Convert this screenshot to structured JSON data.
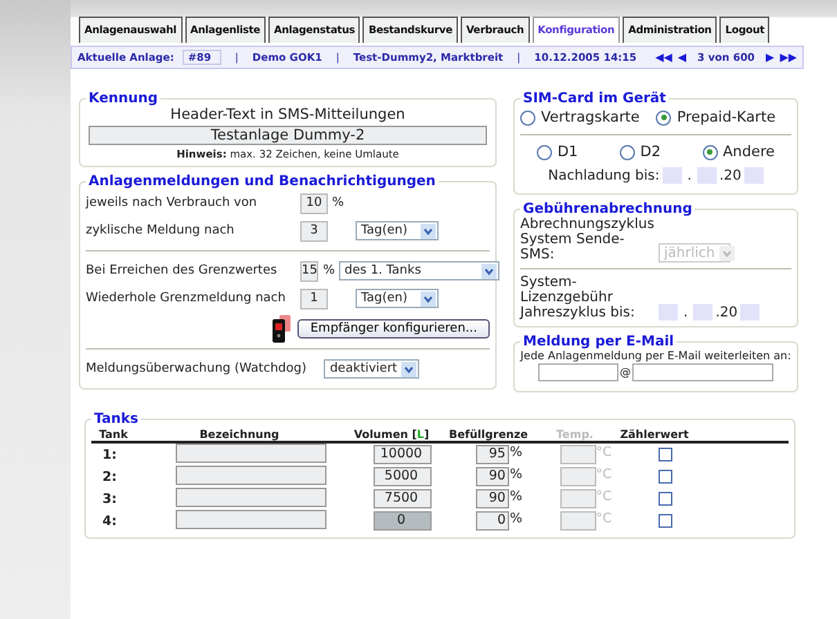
{
  "tabs": [
    {
      "label": "Anlagenauswahl",
      "selected": false
    },
    {
      "label": "Anlagenliste",
      "selected": false
    },
    {
      "label": "Anlagenstatus",
      "selected": false
    },
    {
      "label": "Bestandskurve",
      "selected": false
    },
    {
      "label": "Verbrauch",
      "selected": false
    },
    {
      "label": "Konfiguration",
      "selected": true
    },
    {
      "label": "Administration",
      "selected": false
    },
    {
      "label": "Logout",
      "selected": false
    }
  ],
  "info_bar": {
    "label": "Aktuelle Anlage:",
    "anlage": "#89",
    "items": [
      {
        "kind": "sep",
        "text": "|"
      },
      {
        "kind": "text",
        "text": "Demo GOK1"
      },
      {
        "kind": "sep",
        "text": "|"
      },
      {
        "kind": "text",
        "text": "Test-Dummy2, Marktbreit"
      },
      {
        "kind": "sep",
        "text": "|"
      },
      {
        "kind": "text",
        "text": "10.12.2005 14:15"
      }
    ],
    "nav": {
      "first": "◀◀",
      "prev": "◀",
      "position": "3 von 600",
      "next": "▶",
      "last": "▶▶"
    }
  },
  "kennung": {
    "title": "Kennung",
    "label": "Header-Text in SMS-Mitteilungen",
    "value": "Testanlage Dummy-2",
    "hint": "**Hinweis:** max. 32 Zeichen, keine Umlaute"
  },
  "meldungen": {
    "title": "Anlagenmeldungen und Benachrichtigungen",
    "groups": [
      [
        {
          "label": "jeweils nach Verbrauch von",
          "value": "10",
          "unit": "%"
        },
        {
          "label": "zyklische Meldung nach",
          "value": "3",
          "select": "Tag(en)",
          "wide": false
        }
      ],
      [
        {
          "label": "Bei Erreichen des Grenzwertes",
          "value": "15",
          "unit": "%",
          "select": "des 1. Tanks",
          "wide": true
        },
        {
          "label": "Wiederhole Grenzmeldung nach",
          "value": "1",
          "select": "Tag(en)",
          "wide": false
        }
      ]
    ],
    "button": "Empfänger konfigurieren...",
    "watchdog": {
      "label": "Meldungsüberwachung (Watchdog)",
      "select": "deaktiviert"
    }
  },
  "sim": {
    "title": "SIM-Card im Gerät",
    "card_types": [
      {
        "label": "Vertragskarte",
        "selected": false
      },
      {
        "label": "Prepaid-Karte",
        "selected": true
      }
    ],
    "networks": [
      {
        "label": "D1",
        "selected": false
      },
      {
        "label": "D2",
        "selected": false
      },
      {
        "label": "Andere",
        "selected": true
      }
    ],
    "recharge_label": "Nachladung bis:",
    "date_sep": ".",
    "year_prefix": ".20"
  },
  "gebuehren": {
    "title": "Gebührenabrechnung",
    "cycle_label": "Abrechnungszyklus System Sende-SMS:",
    "cycle_select": "jährlich",
    "license_label": "System-Lizenzgebühr Jahreszyklus bis:",
    "date_sep": ".",
    "year_prefix": ".20"
  },
  "email": {
    "title": "Meldung per E-Mail",
    "text": "Jede Anlagenmeldung per E-Mail weiterleiten an:",
    "at": "@"
  },
  "tanks": {
    "title": "Tanks",
    "columns": {
      "tank": "Tank",
      "name": "Bezeichnung",
      "volume": "Volumen [",
      "unit": "L",
      "volume_end": "]",
      "limit": "Befüllgrenze",
      "temp": "Temp.",
      "counter": "Zählerwert"
    },
    "rows": [
      {
        "tank": "1:",
        "volume": "10000",
        "volume_disabled": false,
        "limit": "95",
        "unit": "%",
        "temp_unit": "°C",
        "counter": false
      },
      {
        "tank": "2:",
        "volume": "5000",
        "volume_disabled": false,
        "limit": "90",
        "unit": "%",
        "temp_unit": "°C",
        "counter": false
      },
      {
        "tank": "3:",
        "volume": "7500",
        "volume_disabled": false,
        "limit": "90",
        "unit": "%",
        "temp_unit": "°C",
        "counter": false
      },
      {
        "tank": "4:",
        "volume": "0",
        "volume_disabled": true,
        "limit": "0",
        "unit": "%",
        "temp_unit": "°C",
        "counter": false
      }
    ]
  }
}
